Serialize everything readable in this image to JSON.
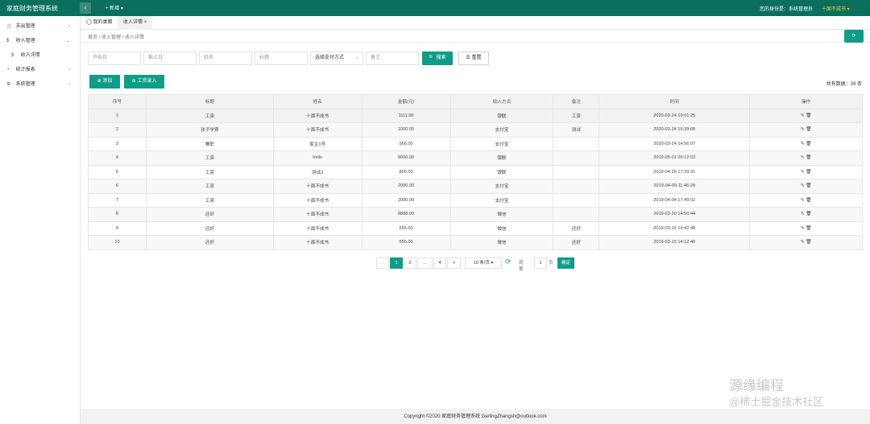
{
  "app": {
    "title": "家庭财务管理系统",
    "collapse": "‹",
    "new_label": "+ 新增 ▾",
    "identity": "您的身份是：系统管理员",
    "user": "十面不成书 ▾"
  },
  "sidebar": {
    "items": [
      {
        "icon": "🛒",
        "label": "支出管理"
      },
      {
        "icon": "$",
        "label": "收入管理"
      },
      {
        "icon": "$",
        "label": "收入详情"
      },
      {
        "icon": "◔",
        "label": "统计报表"
      },
      {
        "icon": "⚙",
        "label": "系统管理"
      }
    ]
  },
  "tabs": [
    {
      "label": "◯ 我的桌面"
    },
    {
      "label": "收入详情  ×"
    }
  ],
  "breadcrumb": "首页  /  收入管理  /  收入详情",
  "refresh_icon": "⟳",
  "filters": {
    "start_date": "开始日",
    "end_date": "截止日",
    "name": "姓名",
    "title": "标题",
    "payment_method": "选择支付方式",
    "remark": "备注",
    "search_btn": "🔍 搜索",
    "reset_btn": "☰ 重置"
  },
  "toolbar": {
    "add_btn": "⊕ 添加",
    "salary_btn": "⊕ 工资录入",
    "total": "共有数据：39 条"
  },
  "table": {
    "headers": [
      "序号",
      "标题",
      "姓名",
      "金额(元)",
      "收入方式",
      "备注",
      "时间",
      "操作"
    ],
    "rows": [
      [
        "1",
        "工资",
        "十面不成书",
        "1111.00",
        "银联",
        "工资",
        "2020-03-24 19:01:25",
        "✎ 🗑"
      ],
      [
        "2",
        "孩子学费",
        "十面不成书",
        "1000.00",
        "支付宝",
        "测试",
        "2020-03-24 15:39:08",
        "✎ 🗑"
      ],
      [
        "3",
        "兼职",
        "家主1号",
        "966.00",
        "支付宝",
        "",
        "2020-03-24 14:56:07",
        "✎ 🗑"
      ],
      [
        "4",
        "工资",
        "hello",
        "8000.00",
        "银联",
        "",
        "2019-05-01 09:12:53",
        "✎ 🗑"
      ],
      [
        "5",
        "工资",
        "测试3",
        "800.00",
        "银联",
        "",
        "2019-04-26 17:29:31",
        "✎ 🗑"
      ],
      [
        "6",
        "工资",
        "十面不成书",
        "2000.00",
        "支付宝",
        "",
        "2019-04-09 11:46:28",
        "✎ 🗑"
      ],
      [
        "7",
        "工资",
        "十面不成书",
        "2000.00",
        "支付宝",
        "",
        "2019-04-04 17:49:52",
        "✎ 🗑"
      ],
      [
        "8",
        "还好",
        "十面不成书",
        "8888.00",
        "微信",
        "",
        "2019-03-30 14:50:44",
        "✎ 🗑"
      ],
      [
        "9",
        "还好",
        "十面不成书",
        "555.00",
        "微信",
        "还好",
        "2019-03-15 14:42:48",
        "✎ 🗑"
      ],
      [
        "10",
        "还好",
        "十面不成书",
        "555.00",
        "微信",
        "还好",
        "2019-03-15 14:12:46",
        "✎ 🗑"
      ]
    ]
  },
  "pager": {
    "prev": "‹",
    "p1": "1",
    "p2": "2",
    "dots": "...",
    "p4": "4",
    "next": ">",
    "size": "10 条/页 ▾",
    "refresh": "⟳",
    "goto": "到第",
    "goto_val": "1",
    "page": "页",
    "confirm": "确定"
  },
  "footer": "Copyright ©2020 家庭财务管理系统 DarlingZhangsh@outlook.com",
  "watermark": {
    "line1": "源缘编程",
    "line2": "@稀土掘金技术社区"
  }
}
